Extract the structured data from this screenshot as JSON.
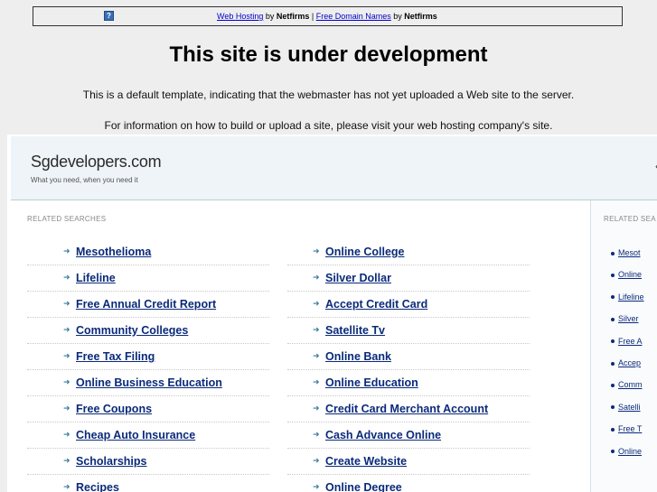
{
  "banner": {
    "link1": "Web Hosting",
    "by1": " by ",
    "brand1": "Netfirms",
    "sep": " | ",
    "link2": "Free Domain Names",
    "by2": " by ",
    "brand2": "Netfirms",
    "icon": "help-icon"
  },
  "title": "This site is under development",
  "paragraph1": "This is a default template, indicating that the webmaster has not yet uploaded a Web site to the server.",
  "paragraph2": "For information on how to build or upload a site, please visit your web hosting company's site.",
  "panel": {
    "site_name": "Sgdevelopers.com",
    "tagline": "What you need, when you need it",
    "related_label": "RELATED SEARCHES",
    "right_related_label": "RELATED SEA",
    "col_a": [
      "Mesothelioma",
      "Lifeline",
      "Free Annual Credit Report",
      "Community Colleges",
      "Free Tax Filing",
      "Online Business Education",
      "Free Coupons",
      "Cheap Auto Insurance",
      "Scholarships",
      "Recipes"
    ],
    "col_b": [
      "Online College",
      "Silver Dollar",
      "Accept Credit Card",
      "Satellite Tv",
      "Online Bank",
      "Online Education",
      "Credit Card Merchant Account",
      "Cash Advance Online",
      "Create Website",
      "Online Degree"
    ],
    "right_list": [
      "Mesot",
      "Online",
      "Lifeline",
      "Silver",
      "Free A",
      "Accep",
      "Comm",
      "Satelli",
      "Free T",
      "Online"
    ]
  },
  "colors": {
    "background": "#eeeeee",
    "link": "#0a2a7a",
    "panel_head": "#eef4f7"
  }
}
